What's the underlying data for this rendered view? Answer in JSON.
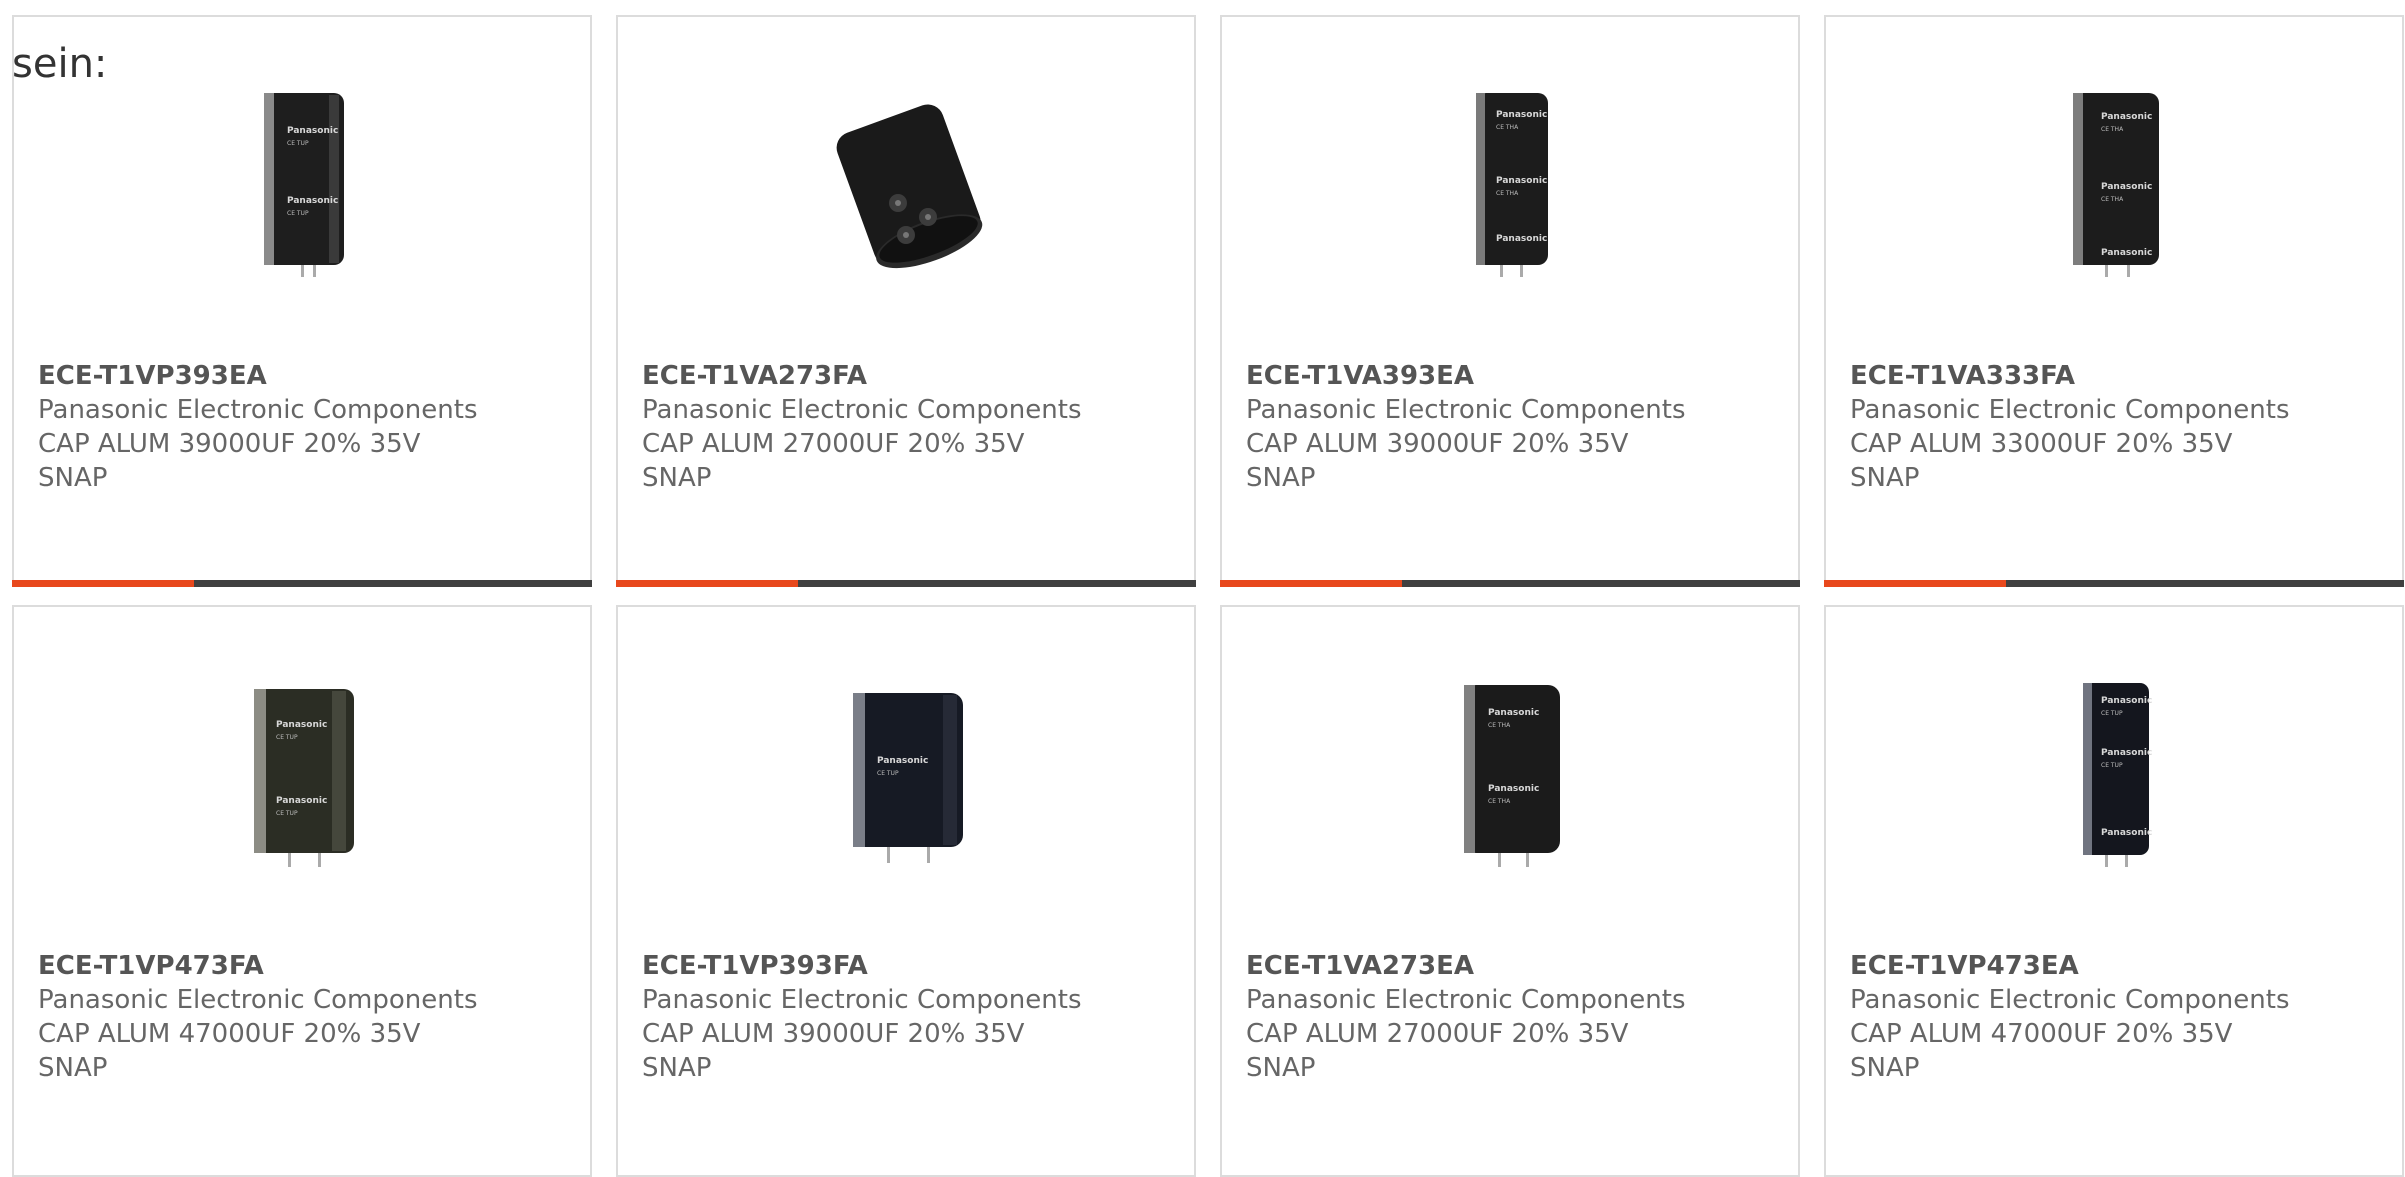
{
  "intro_text": "sein:",
  "colors": {
    "accent": "#e8481c",
    "bar": "#404040",
    "border": "#dcdcdc",
    "text": "#666666"
  },
  "products": [
    {
      "part_number": "ECE-T1VP393EA",
      "manufacturer": "Panasonic Electronic Components",
      "description_line1": "CAP ALUM 39000UF 20% 35V",
      "description_line2": "SNAP",
      "image_label": "Panasonic",
      "image_sub": "CE TUP",
      "image_icon": "capacitor-upright-icon"
    },
    {
      "part_number": "ECE-T1VA273FA",
      "manufacturer": "Panasonic Electronic Components",
      "description_line1": "CAP ALUM 27000UF 20% 35V",
      "description_line2": "SNAP",
      "image_label": "",
      "image_sub": "",
      "image_icon": "capacitor-tilted-icon"
    },
    {
      "part_number": "ECE-T1VA393EA",
      "manufacturer": "Panasonic Electronic Components",
      "description_line1": "CAP ALUM 39000UF 20% 35V",
      "description_line2": "SNAP",
      "image_label": "Panasonic",
      "image_sub": "CE THA",
      "image_icon": "capacitor-upright-icon"
    },
    {
      "part_number": "ECE-T1VA333FA",
      "manufacturer": "Panasonic Electronic Components",
      "description_line1": "CAP ALUM 33000UF 20% 35V",
      "description_line2": "SNAP",
      "image_label": "Panasonic",
      "image_sub": "CE THA",
      "image_icon": "capacitor-upright-icon"
    },
    {
      "part_number": "ECE-T1VP473FA",
      "manufacturer": "Panasonic Electronic Components",
      "description_line1": "CAP ALUM 47000UF 20% 35V",
      "description_line2": "SNAP",
      "image_label": "Panasonic",
      "image_sub": "CE TUP",
      "image_icon": "capacitor-upright-icon"
    },
    {
      "part_number": "ECE-T1VP393FA",
      "manufacturer": "Panasonic Electronic Components",
      "description_line1": "CAP ALUM 39000UF 20% 35V",
      "description_line2": "SNAP",
      "image_label": "Panasonic",
      "image_sub": "CE TUP",
      "image_icon": "capacitor-upright-icon"
    },
    {
      "part_number": "ECE-T1VA273EA",
      "manufacturer": "Panasonic Electronic Components",
      "description_line1": "CAP ALUM 27000UF 20% 35V",
      "description_line2": "SNAP",
      "image_label": "Panasonic",
      "image_sub": "CE THA",
      "image_icon": "capacitor-upright-icon"
    },
    {
      "part_number": "ECE-T1VP473EA",
      "manufacturer": "Panasonic Electronic Components",
      "description_line1": "CAP ALUM 47000UF 20% 35V",
      "description_line2": "SNAP",
      "image_label": "Panasonic",
      "image_sub": "CE TUP",
      "image_icon": "capacitor-upright-icon"
    }
  ]
}
